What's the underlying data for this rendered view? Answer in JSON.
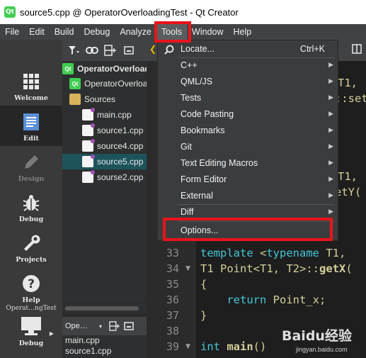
{
  "window": {
    "title": "source5.cpp @ OperatorOverloadingTest - Qt Creator",
    "logo_text": "Qt"
  },
  "menubar": {
    "items": [
      "File",
      "Edit",
      "Build",
      "Debug",
      "Analyze",
      "Tools",
      "Window",
      "Help"
    ]
  },
  "modebar": {
    "modes": [
      {
        "label": "Welcome",
        "icon": "grid-icon",
        "active": false
      },
      {
        "label": "Edit",
        "icon": "edit-document-icon",
        "active": true
      },
      {
        "label": "Design",
        "icon": "pencil-icon",
        "active": false,
        "disabled": true
      },
      {
        "label": "Debug",
        "icon": "bug-icon",
        "active": false
      },
      {
        "label": "Projects",
        "icon": "wrench-icon",
        "active": false
      },
      {
        "label": "Help",
        "icon": "question-icon",
        "active": false
      }
    ],
    "kit_label": "Operat…ngTest",
    "kit_mode_label": "Debug"
  },
  "project_tree": {
    "rows": [
      {
        "label": "OperatorOverloadingTest",
        "icon": "qt-project-icon",
        "bold": true
      },
      {
        "label": "OperatorOverloadingTest.pro",
        "icon": "qt-pro-file-icon",
        "bold": false
      },
      {
        "label": "Sources",
        "icon": "folder-icon",
        "bold": false
      },
      {
        "label": "main.cpp",
        "icon": "cpp-file-icon",
        "bold": false
      },
      {
        "label": "source1.cpp",
        "icon": "cpp-file-icon",
        "bold": false
      },
      {
        "label": "source4.cpp",
        "icon": "cpp-file-icon",
        "bold": false
      },
      {
        "label": "source5.cpp",
        "icon": "cpp-file-icon",
        "bold": false,
        "selected": true
      },
      {
        "label": "sourse2.cpp",
        "icon": "cpp-file-icon",
        "bold": false
      }
    ]
  },
  "open_documents": {
    "combo_label": "Ope…",
    "items": [
      "main.cpp",
      "source1.cpp"
    ]
  },
  "tools_menu": {
    "items": [
      {
        "label": "Locate...",
        "shortcut": "Ctrl+K",
        "submenu": false
      },
      {
        "label": "C++",
        "shortcut": "",
        "submenu": true
      },
      {
        "label": "QML/JS",
        "shortcut": "",
        "submenu": true
      },
      {
        "label": "Tests",
        "shortcut": "",
        "submenu": true
      },
      {
        "label": "Code Pasting",
        "shortcut": "",
        "submenu": true
      },
      {
        "label": "Bookmarks",
        "shortcut": "",
        "submenu": true
      },
      {
        "label": "Git",
        "shortcut": "",
        "submenu": true
      },
      {
        "label": "Text Editing Macros",
        "shortcut": "",
        "submenu": true
      },
      {
        "label": "Form Editor",
        "shortcut": "",
        "submenu": true
      },
      {
        "label": "External",
        "shortcut": "",
        "submenu": true
      },
      {
        "label": "Diff",
        "shortcut": "",
        "submenu": true
      },
      {
        "label": "Options...",
        "shortcut": "",
        "submenu": false
      }
    ]
  },
  "editor": {
    "partial_lines": [
      {
        "text": "T1,"
      },
      {
        "text": "::set"
      },
      {
        "text": "T1,"
      },
      {
        "text": "etY("
      }
    ],
    "lines": [
      {
        "num": "33",
        "fold": false,
        "tokens": [
          {
            "t": "template",
            "c": "kw"
          },
          {
            "t": " <",
            "c": ""
          },
          {
            "t": "typename",
            "c": "kw"
          },
          {
            "t": " T1,",
            "c": ""
          }
        ]
      },
      {
        "num": "34",
        "fold": true,
        "tokens": [
          {
            "t": "T1 Point<T1, T2>::",
            "c": ""
          },
          {
            "t": "getX",
            "c": "fn"
          },
          {
            "t": "(",
            "c": ""
          }
        ]
      },
      {
        "num": "35",
        "fold": false,
        "tokens": [
          {
            "t": "{",
            "c": ""
          }
        ]
      },
      {
        "num": "36",
        "fold": false,
        "tokens": [
          {
            "t": "    ",
            "c": ""
          },
          {
            "t": "return",
            "c": "kw"
          },
          {
            "t": " Point_x;",
            "c": ""
          }
        ]
      },
      {
        "num": "37",
        "fold": false,
        "tokens": [
          {
            "t": "}",
            "c": ""
          }
        ]
      },
      {
        "num": "38",
        "fold": false,
        "tokens": [
          {
            "t": "",
            "c": ""
          }
        ]
      },
      {
        "num": "39",
        "fold": true,
        "tokens": [
          {
            "t": "int",
            "c": "kw"
          },
          {
            "t": " ",
            "c": ""
          },
          {
            "t": "main",
            "c": "fn"
          },
          {
            "t": "()",
            "c": ""
          }
        ]
      }
    ]
  },
  "watermark": {
    "text": "Baidu经验",
    "sub": "jingyan.baidu.com"
  }
}
